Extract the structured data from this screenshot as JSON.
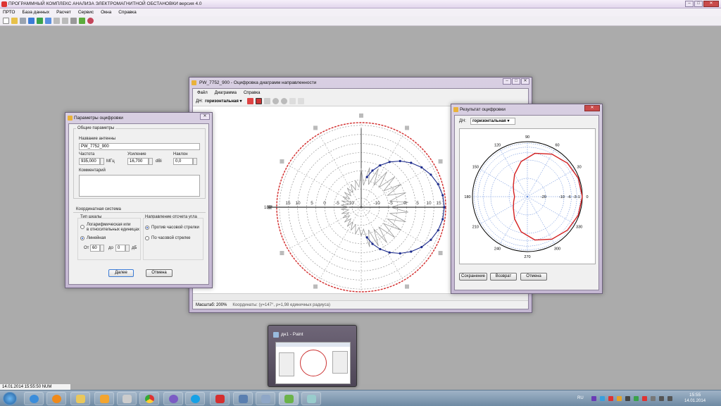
{
  "app": {
    "title": "ПРОГРАММНЫЙ КОМПЛЕКС АНАЛИЗА ЭЛЕКТРОМАГНИТНОЙ ОБСТАНОВКИ версия 4.0",
    "menu": [
      "ПРТО",
      "База данных",
      "Расчет",
      "Сервис",
      "Окна",
      "Справка"
    ],
    "status": "14.01.2014 15:55:50  NUM"
  },
  "params_window": {
    "title": "Параметры оцифровки",
    "general_group": "Общие параметры",
    "antenna_name_label": "Название антенны",
    "antenna_name_value": "PW_7752_900",
    "frequency_label": "Частота",
    "frequency_value": "935,000",
    "frequency_unit": "МГц",
    "gain_label": "Усиление",
    "gain_value": "16,700",
    "gain_unit": "dBi",
    "tilt_label": "Наклон",
    "tilt_value": "0,0",
    "comment_label": "Комментарий",
    "coord_group": "Координатная система",
    "scale_type_label": "Тип шкалы",
    "scale_log_line1": "Логарифмическая или",
    "scale_log_line2": "в относительных единицах",
    "scale_linear": "Линейная",
    "from_label": "От",
    "from_value": "60",
    "to_label": "до",
    "to_value": "0",
    "db_unit": "дБ",
    "direction_label": "Направление отсчета угла",
    "dir_ccw": "Против часовой стрелки",
    "dir_cw": "По часовой стрелке",
    "next_button": "Далее",
    "cancel_button": "Отмена"
  },
  "digit_window": {
    "title": "PW_7752_900 - Оцифровка диаграмм направленности",
    "menu": [
      "Файл",
      "Диаграмма",
      "Справка"
    ],
    "pattern_label": "ДН:",
    "pattern_value": "горизонтальная",
    "zoom_text": "Масштаб: 200%",
    "coords_text": "Координаты: (γ=147°, ρ=1,98 единичных радиуса)",
    "axis_labels": [
      "15",
      "10",
      "5",
      "0",
      "-5",
      "-10",
      "-10",
      "-5",
      "0",
      "5",
      "10",
      "15"
    ],
    "angle_180": "180°",
    "colors": {
      "outer_circle": "#d22b2b",
      "trace": "#1b2a8c",
      "grid": "#8a8a8a"
    }
  },
  "result_window": {
    "title": "Результат оцифровки",
    "pattern_label": "ДН:",
    "pattern_value": "горизонтальная",
    "save_button": "Сохранение",
    "back_button": "Возврат",
    "cancel_button": "Отмена",
    "angle_labels": [
      "0",
      "30",
      "60",
      "90",
      "120",
      "150",
      "180",
      "210",
      "240",
      "270",
      "300",
      "330"
    ],
    "radial_labels": [
      "-20",
      "-10",
      "-6",
      "-3",
      "-1"
    ]
  },
  "chart_data": {
    "type": "polar-line",
    "title": "",
    "angle_ticks_deg": [
      0,
      30,
      60,
      90,
      120,
      150,
      180,
      210,
      240,
      270,
      300,
      330
    ],
    "radial_ticks_db": [
      -20,
      -10,
      -6,
      -3,
      -1
    ],
    "direction": "counterclockwise",
    "series": [
      {
        "angles_deg": [
          0,
          20,
          40,
          60,
          80,
          100,
          120,
          140,
          160,
          180,
          200,
          220,
          240,
          260,
          280,
          300,
          320,
          340
        ],
        "values_db": [
          0,
          -0.4,
          -1.5,
          -3.2,
          -6,
          -10.5,
          -16,
          -20,
          -22,
          -23,
          -22,
          -20,
          -16,
          -10.5,
          -6,
          -3.2,
          -1.5,
          -0.4
        ]
      }
    ],
    "colors": {
      "pattern": "#d42020",
      "circle": "#000000",
      "grid": "#4a78d6"
    }
  },
  "paint_thumb": {
    "title": "дн1 - Paint"
  },
  "taskbar": {
    "lang": "RU",
    "time": "15:55",
    "date": "14.01.2014"
  }
}
